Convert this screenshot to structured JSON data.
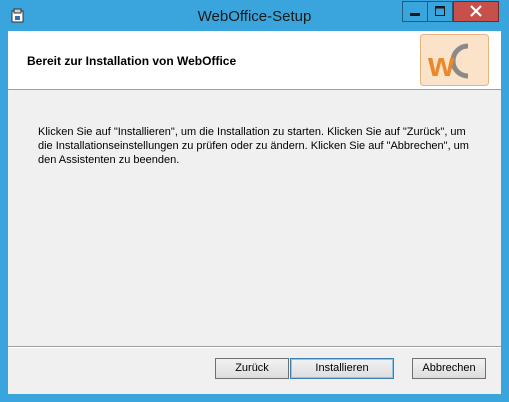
{
  "window": {
    "title": "WebOffice-Setup"
  },
  "banner": {
    "title": "Bereit zur Installation von WebOffice",
    "logo_icon": "weboffice-logo"
  },
  "body": {
    "message": "Klicken Sie auf \"Installieren\", um die Installation zu starten. Klicken Sie auf \"Zurück\", um die Installationseinstellungen zu prüfen oder zu ändern. Klicken Sie auf \"Abbrechen\", um den Assistenten zu beenden."
  },
  "buttons": {
    "back_label": "Zurück",
    "install_label": "Installieren",
    "cancel_label": "Abbrechen"
  },
  "colors": {
    "frame": "#3aa4dc",
    "close_button": "#c7504b",
    "logo_orange": "#e8892d",
    "logo_gray": "#8a8a8a"
  }
}
